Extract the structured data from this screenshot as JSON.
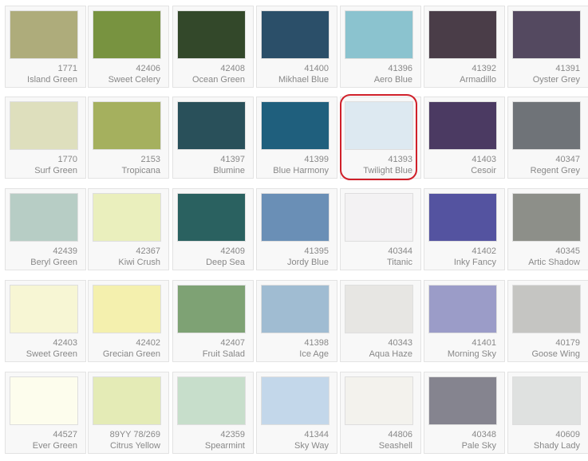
{
  "selected_index": 11,
  "highlight_color": "#d0202a",
  "swatches": [
    {
      "code": "1771",
      "name": "Island Green",
      "color": "#aeac7b"
    },
    {
      "code": "42406",
      "name": "Sweet Celery",
      "color": "#789340"
    },
    {
      "code": "42408",
      "name": "Ocean Green",
      "color": "#33482a"
    },
    {
      "code": "41400",
      "name": "Mikhael Blue",
      "color": "#2b4f69"
    },
    {
      "code": "41396",
      "name": "Aero Blue",
      "color": "#8bc3cf"
    },
    {
      "code": "41392",
      "name": "Armadillo",
      "color": "#4a3d48"
    },
    {
      "code": "41391",
      "name": "Oyster Grey",
      "color": "#544960"
    },
    {
      "code": "1770",
      "name": "Surf Green",
      "color": "#dedfbd"
    },
    {
      "code": "2153",
      "name": "Tropicana",
      "color": "#a5b05e"
    },
    {
      "code": "41397",
      "name": "Blumine",
      "color": "#29505a"
    },
    {
      "code": "41399",
      "name": "Blue Harmony",
      "color": "#1f5f7d"
    },
    {
      "code": "41393",
      "name": "Twilight Blue",
      "color": "#dde9f1"
    },
    {
      "code": "41403",
      "name": "Cesoir",
      "color": "#4b3a62"
    },
    {
      "code": "40347",
      "name": "Regent Grey",
      "color": "#6f7378"
    },
    {
      "code": "42439",
      "name": "Beryl Green",
      "color": "#b7cdc5"
    },
    {
      "code": "42367",
      "name": "Kiwi Crush",
      "color": "#eaefbd"
    },
    {
      "code": "42409",
      "name": "Deep Sea",
      "color": "#2a6160"
    },
    {
      "code": "41395",
      "name": "Jordy Blue",
      "color": "#6a8fb6"
    },
    {
      "code": "40344",
      "name": "Titanic",
      "color": "#f3f2f3"
    },
    {
      "code": "41402",
      "name": "Inky Fancy",
      "color": "#5453a0"
    },
    {
      "code": "40345",
      "name": "Artic Shadow",
      "color": "#8d8f89"
    },
    {
      "code": "42403",
      "name": "Sweet Green",
      "color": "#f7f6d4"
    },
    {
      "code": "42402",
      "name": "Grecian Green",
      "color": "#f4f0ae"
    },
    {
      "code": "42407",
      "name": "Fruit Salad",
      "color": "#7ea274"
    },
    {
      "code": "41398",
      "name": "Ice Age",
      "color": "#a0bcd2"
    },
    {
      "code": "40343",
      "name": "Aqua Haze",
      "color": "#e7e6e3"
    },
    {
      "code": "41401",
      "name": "Morning Sky",
      "color": "#9b9cc8"
    },
    {
      "code": "40179",
      "name": "Goose Wing",
      "color": "#c5c5c2"
    },
    {
      "code": "44527",
      "name": "Ever Green",
      "color": "#fdfded"
    },
    {
      "code": "89YY 78/269",
      "name": "Citrus Yellow",
      "color": "#e4ebb6"
    },
    {
      "code": "42359",
      "name": "Spearmint",
      "color": "#c7decb"
    },
    {
      "code": "41344",
      "name": "Sky Way",
      "color": "#c3d7ea"
    },
    {
      "code": "44806",
      "name": "Seashell",
      "color": "#f3f2ed"
    },
    {
      "code": "40348",
      "name": "Pale Sky",
      "color": "#85848f"
    },
    {
      "code": "40609",
      "name": "Shady Lady",
      "color": "#dfe1e0"
    }
  ]
}
